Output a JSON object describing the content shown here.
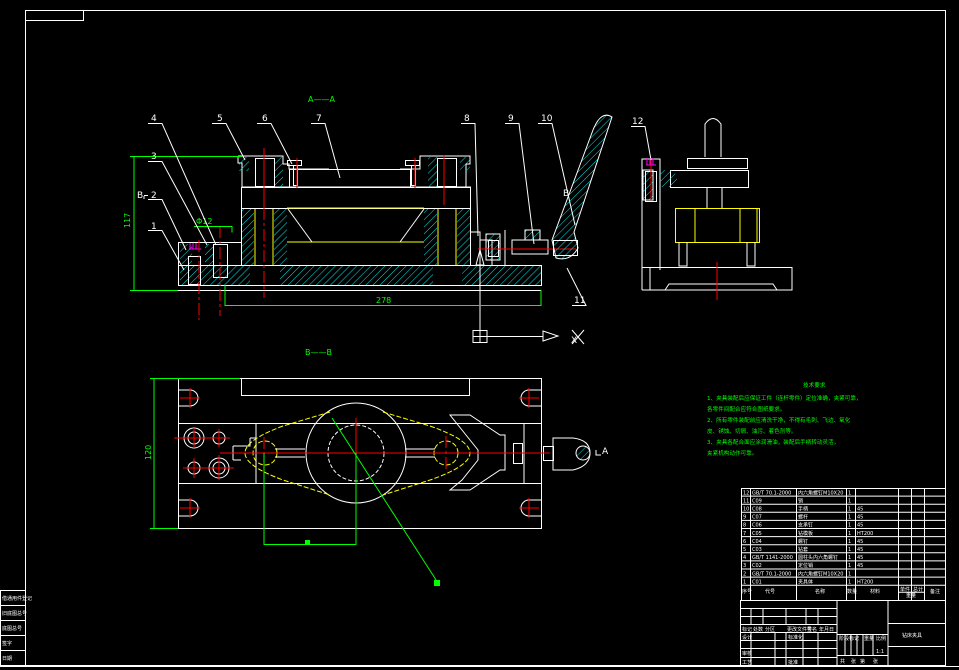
{
  "colors": {
    "background": "#000000",
    "outline": "#ffffff",
    "hidden": "#ffff00",
    "center": "#ff0000",
    "dimension": "#00ff00",
    "hatch": "#00ffff",
    "screw": "#ff00ff"
  },
  "views": {
    "section_aa": "A——A",
    "section_bb": "B——B",
    "section_mark_b": "B",
    "view_mark_a": "A",
    "axis_x": "X"
  },
  "dimensions": {
    "height": "117",
    "length": "278",
    "width": "120",
    "fit": "Φ12"
  },
  "balloons": [
    "1",
    "2",
    "3",
    "4",
    "5",
    "6",
    "7",
    "8",
    "9",
    "10",
    "11",
    "12"
  ],
  "technical_requirements": {
    "title": "技术要求",
    "lines": [
      "1、夹具装配后应保证工件（连杆零件）定位准确，夹紧可靠，",
      "各零件间配合应符合图纸要求。",
      "2、所有零件装配前应清洗干净，不得有毛刺、飞边、氧化",
      "皮、锈蚀、切屑、油污、着色剂等。",
      "3、夹具各配合面应涂润滑油，装配后手柄转动灵活，",
      "夹紧机构动作可靠。"
    ]
  },
  "parts_list": {
    "rows": [
      {
        "no": "12",
        "code": "GB/T 70.1-2000",
        "name": "内六角螺钉M10X20",
        "qty": "1",
        "material": ""
      },
      {
        "no": "11",
        "code": "C09",
        "name": "销",
        "qty": "1",
        "material": ""
      },
      {
        "no": "10",
        "code": "C08",
        "name": "手柄",
        "qty": "1",
        "material": "45"
      },
      {
        "no": "9",
        "code": "C07",
        "name": "螺杆",
        "qty": "1",
        "material": "45"
      },
      {
        "no": "8",
        "code": "C06",
        "name": "支承钉",
        "qty": "1",
        "material": "45"
      },
      {
        "no": "7",
        "code": "C05",
        "name": "钻模板",
        "qty": "1",
        "material": "HT200"
      },
      {
        "no": "6",
        "code": "C04",
        "name": "螺钉",
        "qty": "1",
        "material": "45"
      },
      {
        "no": "5",
        "code": "C03",
        "name": "钻套",
        "qty": "1",
        "material": "45"
      },
      {
        "no": "4",
        "code": "GB/T 1141-2000",
        "name": "圆柱头内六角螺钉",
        "qty": "1",
        "material": "45"
      },
      {
        "no": "3",
        "code": "C02",
        "name": "定位销",
        "qty": "1",
        "material": "45"
      },
      {
        "no": "2",
        "code": "GB/T 70.1-2000",
        "name": "内六角螺钉M10X20",
        "qty": "1",
        "material": ""
      },
      {
        "no": "1",
        "code": "C01",
        "name": "夹具体",
        "qty": "1",
        "material": "HT200"
      }
    ],
    "header": {
      "no": "序号",
      "code": "代号",
      "name": "名称",
      "qty": "数量",
      "material": "材料",
      "single": "单件",
      "total": "总计",
      "weight": "重量",
      "remark": "备注"
    }
  },
  "title_block": {
    "mark": "标记",
    "count": "处数",
    "zone": "分区",
    "change_doc": "更改文件号",
    "sign": "签名",
    "date": "年月日",
    "design": "设计",
    "standard": "标准化",
    "check": "审核",
    "process": "工艺",
    "approve": "批准",
    "stage": "阶段标记",
    "weight": "重量",
    "scale": "比例",
    "scale_value": "1:1",
    "sheet_total": "共",
    "sheet_unit": "张",
    "sheet_no": "第",
    "sheet_unit2": "张",
    "drawing_name": "钻床夹具"
  },
  "side_strip": [
    "借通用件登记",
    "旧底图总号",
    "底图总号",
    "签字",
    "日期"
  ]
}
